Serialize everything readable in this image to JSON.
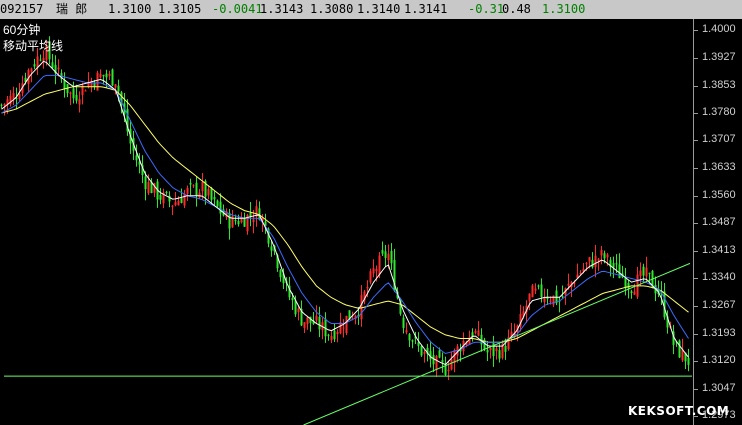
{
  "quote_bar": {
    "code": "092157",
    "name": "瑞  郎",
    "open": "1.3100",
    "high_prev": "1.3105",
    "change": "-0.0041",
    "v1": "1.3143",
    "v2": "1.3080",
    "v3": "1.3140",
    "v4": "1.3141",
    "pct_change": "-0.31",
    "v5": "0.48",
    "last": "1.3100"
  },
  "chart_title": "60分钟",
  "chart_subtitle": "移动平均线",
  "watermark": "KEKSOFT.COM",
  "colors": {
    "up": "#ff2a2a",
    "down": "#2ee82e",
    "ma_short": "#ffffff",
    "ma_mid": "#3a6bff",
    "ma_long": "#ffff66",
    "trendline": "#66ff66",
    "support": "#66ff66"
  },
  "chart_data": {
    "type": "line",
    "ylim": [
      1.295,
      1.403
    ],
    "y_ticks": [
      "1.4000",
      "1.3927",
      "1.3853",
      "1.3780",
      "1.3707",
      "1.3633",
      "1.3560",
      "1.3487",
      "1.3413",
      "1.3340",
      "1.3267",
      "1.3193",
      "1.3120",
      "1.3047",
      "1.2973"
    ],
    "close_path": [
      1.38,
      1.383,
      1.39,
      1.395,
      1.388,
      1.382,
      1.386,
      1.388,
      1.387,
      1.37,
      1.36,
      1.356,
      1.354,
      1.357,
      1.358,
      1.353,
      1.349,
      1.35,
      1.352,
      1.342,
      1.33,
      1.323,
      1.322,
      1.319,
      1.323,
      1.326,
      1.336,
      1.341,
      1.323,
      1.316,
      1.312,
      1.31,
      1.316,
      1.32,
      1.314,
      1.315,
      1.32,
      1.33,
      1.33,
      1.328,
      1.334,
      1.338,
      1.34,
      1.336,
      1.332,
      1.335,
      1.33,
      1.316,
      1.312
    ],
    "ma_short": [
      1.379,
      1.382,
      1.388,
      1.392,
      1.388,
      1.385,
      1.386,
      1.387,
      1.384,
      1.372,
      1.362,
      1.357,
      1.355,
      1.356,
      1.356,
      1.353,
      1.35,
      1.35,
      1.351,
      1.343,
      1.332,
      1.325,
      1.322,
      1.32,
      1.322,
      1.326,
      1.333,
      1.338,
      1.326,
      1.318,
      1.313,
      1.311,
      1.315,
      1.319,
      1.316,
      1.316,
      1.32,
      1.328,
      1.329,
      1.329,
      1.333,
      1.337,
      1.339,
      1.336,
      1.333,
      1.334,
      1.33,
      1.318,
      1.313
    ],
    "ma_mid": [
      1.378,
      1.38,
      1.384,
      1.388,
      1.388,
      1.387,
      1.386,
      1.386,
      1.384,
      1.376,
      1.368,
      1.362,
      1.358,
      1.356,
      1.355,
      1.353,
      1.351,
      1.35,
      1.35,
      1.345,
      1.337,
      1.33,
      1.325,
      1.322,
      1.322,
      1.324,
      1.329,
      1.333,
      1.328,
      1.322,
      1.317,
      1.314,
      1.315,
      1.317,
      1.317,
      1.317,
      1.319,
      1.324,
      1.327,
      1.328,
      1.331,
      1.334,
      1.336,
      1.335,
      1.334,
      1.333,
      1.331,
      1.324,
      1.318
    ],
    "ma_long": [
      1.378,
      1.379,
      1.381,
      1.383,
      1.384,
      1.385,
      1.385,
      1.385,
      1.384,
      1.38,
      1.375,
      1.37,
      1.366,
      1.363,
      1.36,
      1.357,
      1.354,
      1.352,
      1.351,
      1.348,
      1.343,
      1.337,
      1.332,
      1.329,
      1.327,
      1.326,
      1.327,
      1.328,
      1.327,
      1.324,
      1.321,
      1.319,
      1.318,
      1.318,
      1.317,
      1.317,
      1.318,
      1.32,
      1.322,
      1.324,
      1.326,
      1.328,
      1.33,
      1.331,
      1.332,
      1.332,
      1.331,
      1.328,
      1.325
    ],
    "support_level": 1.308,
    "trendline": [
      [
        0.44,
        1.295
      ],
      [
        1.0,
        1.338
      ]
    ]
  }
}
